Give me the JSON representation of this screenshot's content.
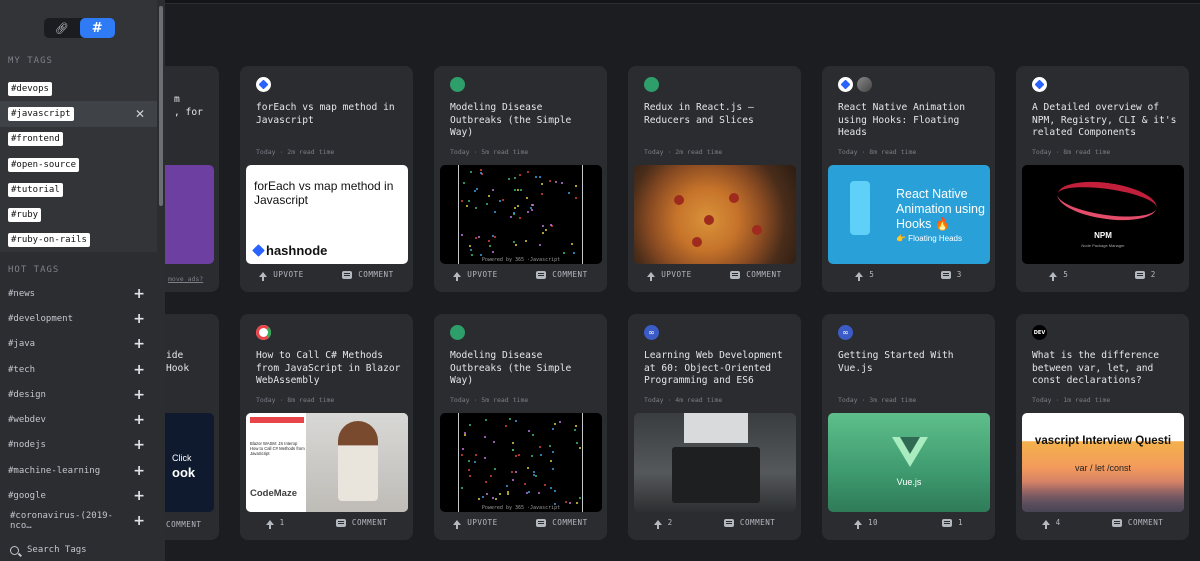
{
  "toggle": {
    "link_icon": "link-icon",
    "hash_label": "#"
  },
  "my_tags": {
    "heading": "MY TAGS",
    "items": [
      "#devops",
      "#javascript",
      "#frontend",
      "#open-source",
      "#tutorial",
      "#ruby",
      "#ruby-on-rails"
    ],
    "selected": "#javascript",
    "remove_glyph": "✕"
  },
  "hot_tags": {
    "heading": "HOT TAGS",
    "items": [
      "#news",
      "#development",
      "#java",
      "#tech",
      "#design",
      "#webdev",
      "#nodejs",
      "#machine-learning",
      "#google",
      "#coronavirus-(2019-nco…"
    ],
    "add_glyph": "+"
  },
  "search": {
    "placeholder": "Search Tags"
  },
  "partial": {
    "r1_title": "m\n, for",
    "r1_ads": "move ads?",
    "r2_title": "ide\nHook",
    "r2_thumb_line1": "Click",
    "r2_thumb_line2": "ook",
    "r2_comment": "COMMENT"
  },
  "cards": [
    {
      "title": "forEach vs map method in Javascript",
      "meta": "Today · 2m read time",
      "up": "UPVOTE",
      "cm": "COMMENT",
      "thumb_title": "forEach vs map method in Javascript",
      "thumb_logo": "hashnode"
    },
    {
      "title": "Modeling Disease Outbreaks (the Simple Way)",
      "meta": "Today · 5m read time",
      "up": "UPVOTE",
      "cm": "COMMENT",
      "thumb_caption": "Powered by 365 ·Javascript"
    },
    {
      "title": "Redux in React.js – Reducers and Slices",
      "meta": "Today · 2m read time",
      "up": "UPVOTE",
      "cm": "COMMENT"
    },
    {
      "title": "React Native Animation using Hooks: Floating Heads",
      "meta": "Today · 8m read time",
      "up": "5",
      "cm": "3",
      "thumb_title": "React Native Animation using Hooks 🔥",
      "thumb_sub": "👉 Floating Heads"
    },
    {
      "title": "A Detailed overview of NPM, Registry, CLI & it's related Components",
      "meta": "Today · 8m read time",
      "up": "5",
      "cm": "2",
      "thumb_title": "NPM",
      "thumb_sub": "Node Package Manager"
    },
    {
      "title": "How to Call C# Methods from JavaScript in Blazor WebAssembly",
      "meta": "Today · 8m read time",
      "up": "1",
      "cm": "COMMENT",
      "thumb_text": "Blazor WASM: JS Interop How to Call C# Methods from JavaScript",
      "thumb_logo": "CodeMaze"
    },
    {
      "title": "Modeling Disease Outbreaks (the Simple Way)",
      "meta": "Today · 5m read time",
      "up": "UPVOTE",
      "cm": "COMMENT",
      "thumb_caption": "Powered by 365 ·Javascript"
    },
    {
      "title": "Learning Web Development at 60: Object-Oriented Programming and ES6",
      "meta": "Today · 4m read time",
      "up": "2",
      "cm": "COMMENT"
    },
    {
      "title": "Getting Started With Vue.js",
      "meta": "Today · 3m read time",
      "up": "10",
      "cm": "1",
      "thumb_label": "Vue.js"
    },
    {
      "title": "What is the difference between var, let, and const declarations?",
      "meta": "Today · 1m read time",
      "up": "4",
      "cm": "COMMENT",
      "thumb_title": "vascript Interview Questi",
      "thumb_sub": "var / let /const"
    }
  ],
  "colors": {
    "accent": "#2f7bf6",
    "background": "#1c1d20",
    "card": "#2a2c30",
    "sidebar": "#2b2d31"
  }
}
